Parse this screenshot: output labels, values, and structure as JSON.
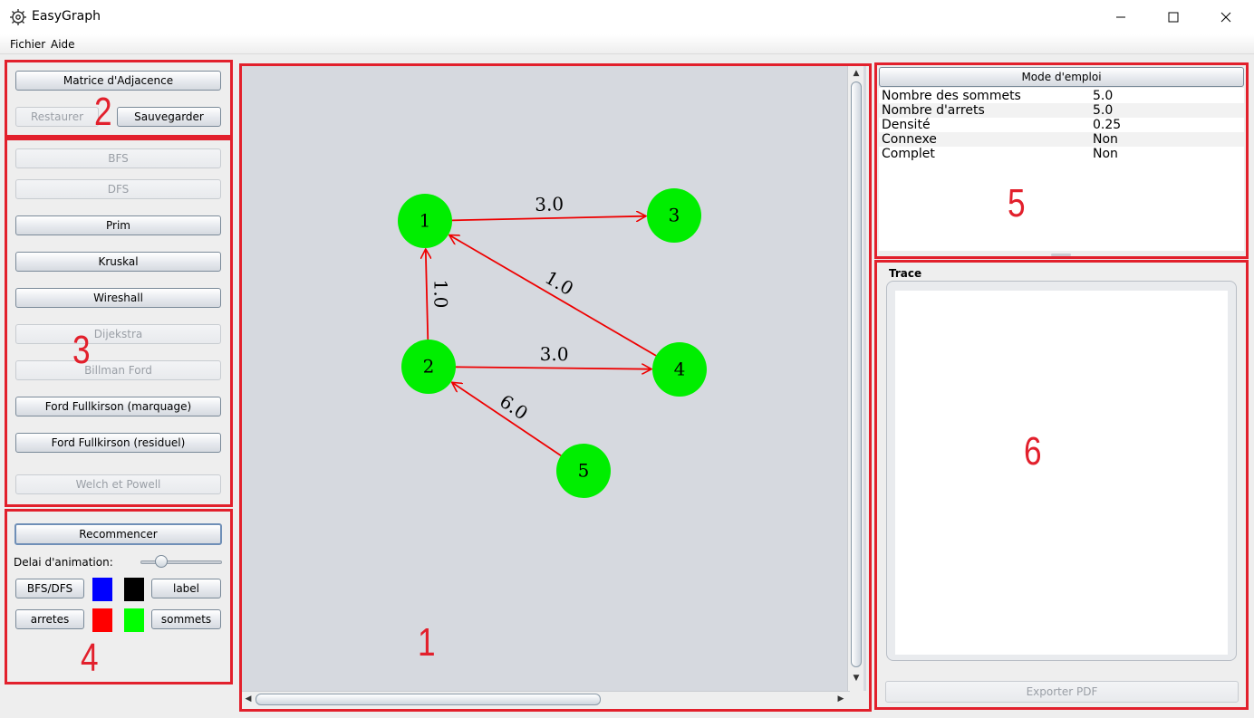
{
  "window": {
    "title": "EasyGraph",
    "controls": [
      "minimize-icon",
      "maximize-icon",
      "close-icon"
    ]
  },
  "menu": {
    "items": [
      "Fichier",
      "Aide"
    ]
  },
  "panel_file": {
    "adjacency_button": "Matrice d'Adjacence",
    "restore_button": "Restaurer",
    "save_button": "Sauvegarder"
  },
  "panel_algorithms": {
    "buttons": [
      {
        "label": "BFS",
        "enabled": false
      },
      {
        "label": "DFS",
        "enabled": false
      },
      {
        "label": "Prim",
        "enabled": true
      },
      {
        "label": "Kruskal",
        "enabled": true
      },
      {
        "label": "Wireshall",
        "enabled": true
      },
      {
        "label": "Dijekstra",
        "enabled": false
      },
      {
        "label": "Billman Ford",
        "enabled": false
      },
      {
        "label": "Ford Fullkirson (marquage)",
        "enabled": true
      },
      {
        "label": "Ford Fullkirson (residuel)",
        "enabled": true
      },
      {
        "label": "Welch et Powell",
        "enabled": false
      }
    ]
  },
  "panel_animation": {
    "restart_button": "Recommencer",
    "delay_label": "Delai d'animation:",
    "delay_fraction": 0.2,
    "bfs_dfs_button": "BFS/DFS",
    "label_button": "label",
    "edges_button": "arretes",
    "vertices_button": "sommets",
    "colors": {
      "bfs_dfs": "#0000ff",
      "label": "#000000",
      "edges": "#ff0000",
      "vertices": "#00ff00"
    }
  },
  "graph": {
    "vertex_color": "#00ee00",
    "edge_color": "#ee0000",
    "vertices": [
      "1",
      "2",
      "3",
      "4",
      "5"
    ],
    "edges": [
      {
        "from": "1",
        "to": "3",
        "weight": "3.0"
      },
      {
        "from": "2",
        "to": "1",
        "weight": "1.0"
      },
      {
        "from": "4",
        "to": "1",
        "weight": "1.0"
      },
      {
        "from": "2",
        "to": "4",
        "weight": "3.0"
      },
      {
        "from": "5",
        "to": "2",
        "weight": "6.0"
      }
    ]
  },
  "panel_stats": {
    "manual_button": "Mode d'emploi",
    "rows": [
      {
        "label": "Nombre des sommets",
        "value": "5.0"
      },
      {
        "label": "Nombre d'arrets",
        "value": "5.0"
      },
      {
        "label": "Densité",
        "value": "0.25"
      },
      {
        "label": "Connexe",
        "value": "Non"
      },
      {
        "label": "Complet",
        "value": "Non"
      }
    ]
  },
  "panel_trace": {
    "title": "Trace",
    "content": "",
    "export_button": "Exporter PDF"
  },
  "annotations": [
    "1",
    "2",
    "3",
    "4",
    "5",
    "6"
  ],
  "annotation_color": "#e2202c"
}
